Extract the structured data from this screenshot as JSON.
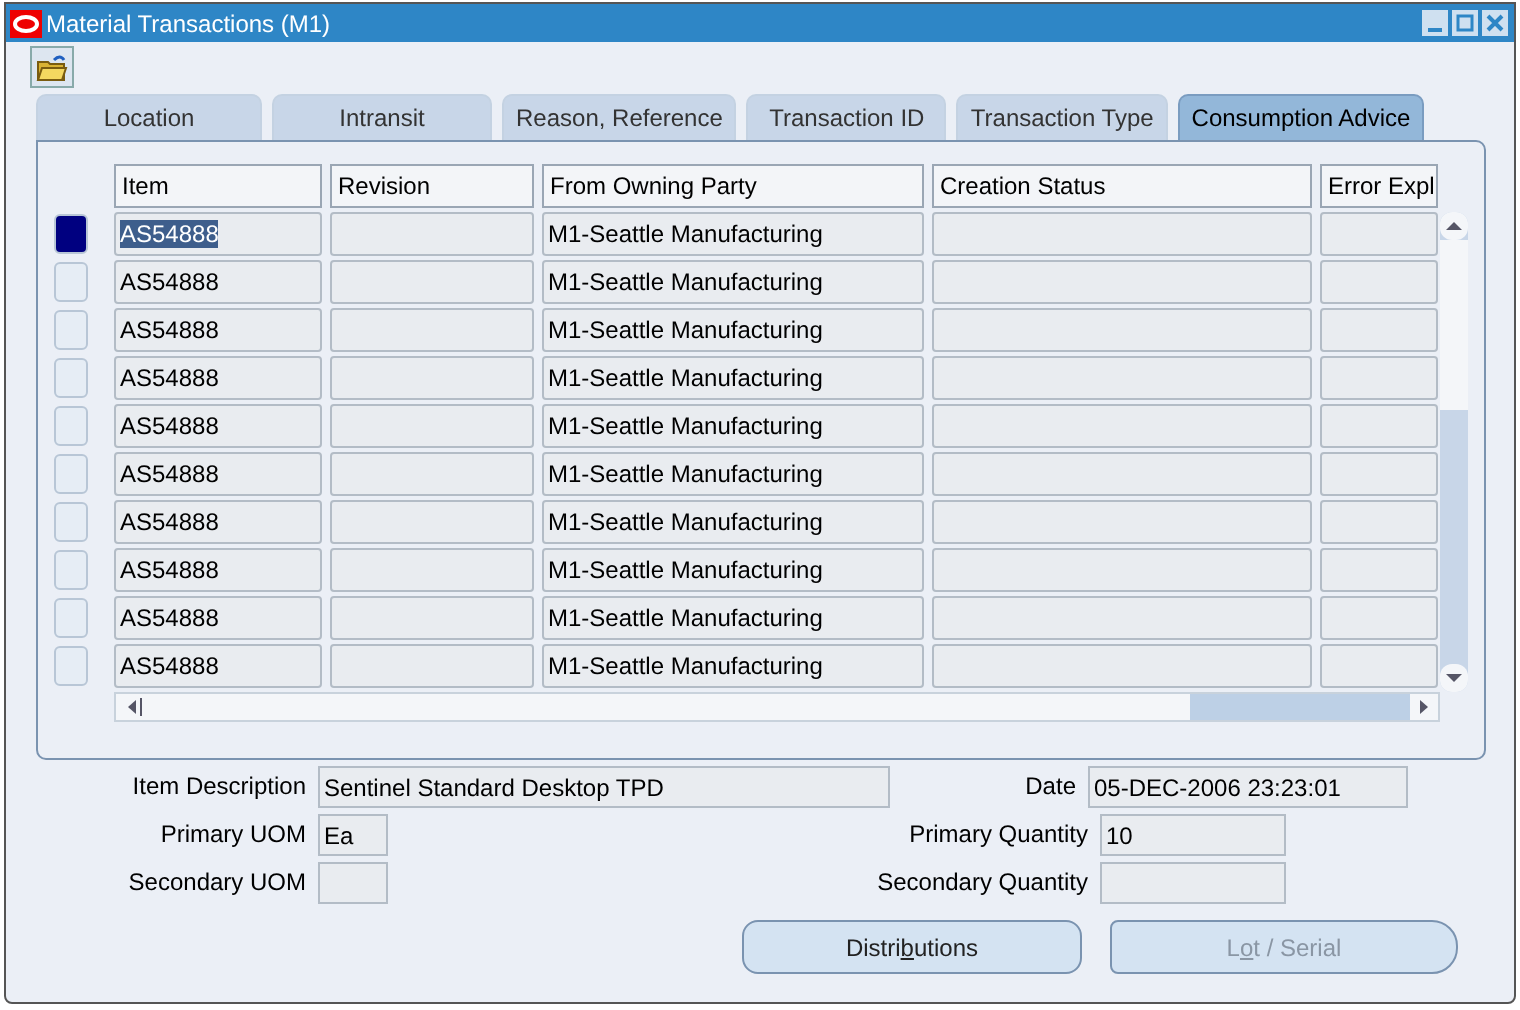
{
  "window": {
    "title": "Material Transactions (M1)"
  },
  "tabs": [
    {
      "label": "Location",
      "selected": false
    },
    {
      "label": "Intransit",
      "selected": false
    },
    {
      "label": "Reason, Reference",
      "selected": false
    },
    {
      "label": "Transaction ID",
      "selected": false
    },
    {
      "label": "Transaction Type",
      "selected": false
    },
    {
      "label": "Consumption Advice",
      "selected": true
    }
  ],
  "table": {
    "columns": [
      "Item",
      "Revision",
      "From Owning Party",
      "Creation Status",
      "Error Expl"
    ],
    "rows": [
      {
        "selected": true,
        "cells": [
          "AS54888",
          "",
          "M1-Seattle Manufacturing",
          "",
          ""
        ]
      },
      {
        "selected": false,
        "cells": [
          "AS54888",
          "",
          "M1-Seattle Manufacturing",
          "",
          ""
        ]
      },
      {
        "selected": false,
        "cells": [
          "AS54888",
          "",
          "M1-Seattle Manufacturing",
          "",
          ""
        ]
      },
      {
        "selected": false,
        "cells": [
          "AS54888",
          "",
          "M1-Seattle Manufacturing",
          "",
          ""
        ]
      },
      {
        "selected": false,
        "cells": [
          "AS54888",
          "",
          "M1-Seattle Manufacturing",
          "",
          ""
        ]
      },
      {
        "selected": false,
        "cells": [
          "AS54888",
          "",
          "M1-Seattle Manufacturing",
          "",
          ""
        ]
      },
      {
        "selected": false,
        "cells": [
          "AS54888",
          "",
          "M1-Seattle Manufacturing",
          "",
          ""
        ]
      },
      {
        "selected": false,
        "cells": [
          "AS54888",
          "",
          "M1-Seattle Manufacturing",
          "",
          ""
        ]
      },
      {
        "selected": false,
        "cells": [
          "AS54888",
          "",
          "M1-Seattle Manufacturing",
          "",
          ""
        ]
      },
      {
        "selected": false,
        "cells": [
          "AS54888",
          "",
          "M1-Seattle Manufacturing",
          "",
          ""
        ]
      }
    ]
  },
  "fields": {
    "item_description": {
      "label": "Item Description",
      "value": "Sentinel Standard Desktop TPD"
    },
    "date": {
      "label": "Date",
      "value": "05-DEC-2006 23:23:01"
    },
    "primary_uom": {
      "label": "Primary UOM",
      "value": "Ea"
    },
    "primary_quantity": {
      "label": "Primary Quantity",
      "value": "10"
    },
    "secondary_uom": {
      "label": "Secondary UOM"
    },
    "secondary_quantity": {
      "label": "Secondary Quantity"
    }
  },
  "buttons": [
    {
      "label_parts": [
        "Distri",
        "b",
        "utions"
      ],
      "disabled": false
    },
    {
      "label_parts": [
        "L",
        "o",
        "t / Serial"
      ],
      "disabled": true
    }
  ]
}
